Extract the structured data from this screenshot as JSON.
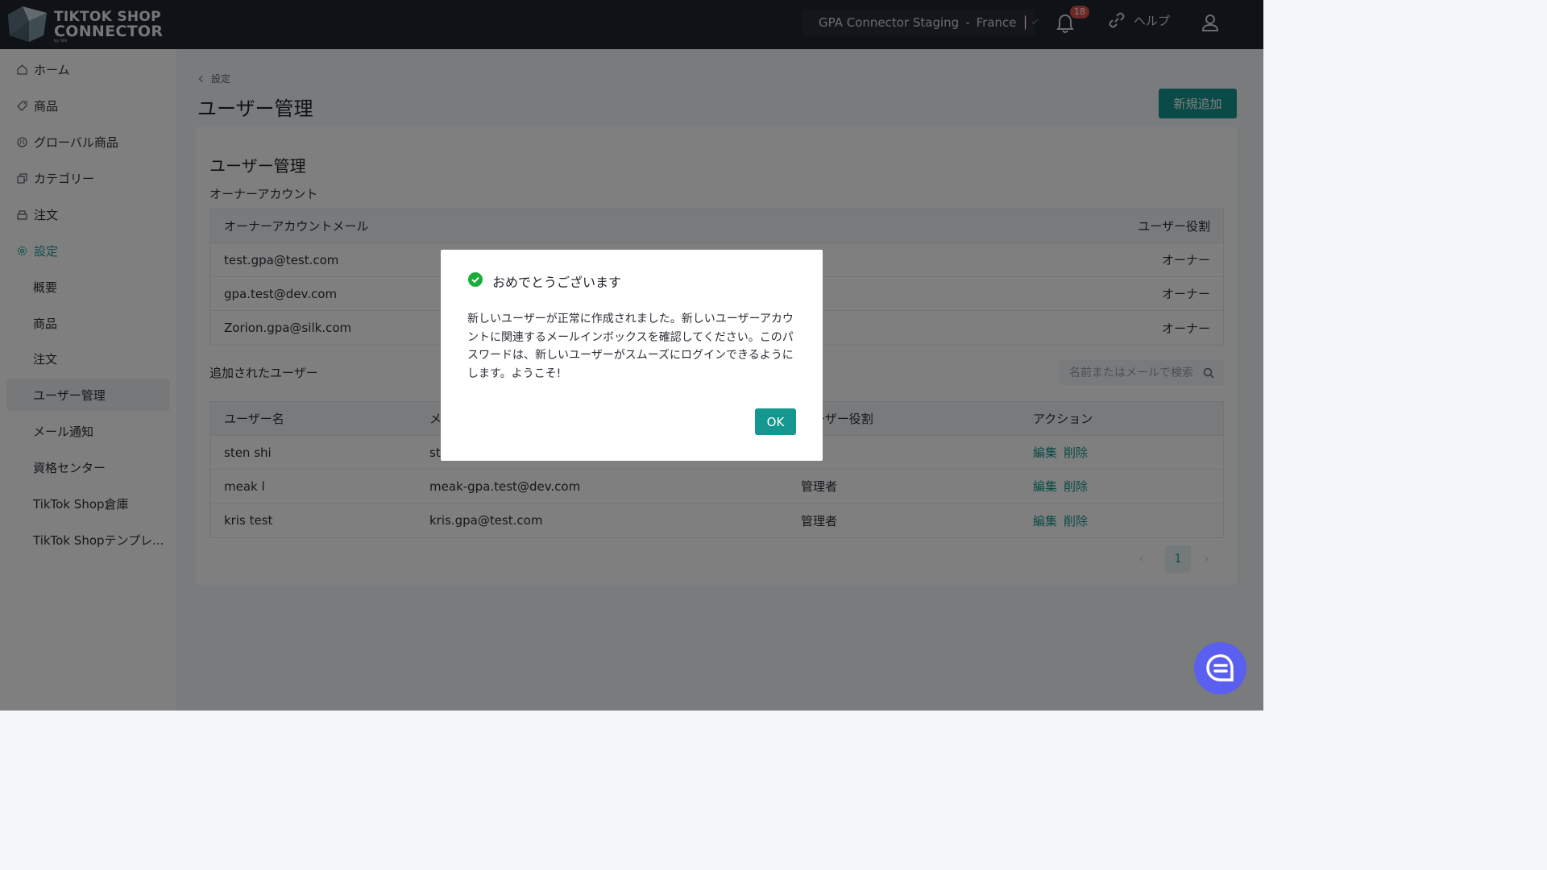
{
  "header": {
    "logo": {
      "line1": "TIKTOK SHOP",
      "line2": "CONNECTOR",
      "byline": "by Silk"
    },
    "store": {
      "name": "GPA Connector Staging",
      "separator": "-",
      "country": "France"
    },
    "notifications_count": "18",
    "help_label": "ヘルプ"
  },
  "sidebar": {
    "items": [
      {
        "label": "ホーム",
        "icon": "home-icon"
      },
      {
        "label": "商品",
        "icon": "tag-icon"
      },
      {
        "label": "グローバル商品",
        "icon": "globe-icon"
      },
      {
        "label": "カテゴリー",
        "icon": "category-icon"
      },
      {
        "label": "注文",
        "icon": "order-icon"
      },
      {
        "label": "設定",
        "icon": "gear-icon",
        "active": true
      }
    ],
    "sub_items": [
      {
        "label": "概要"
      },
      {
        "label": "商品"
      },
      {
        "label": "注文"
      },
      {
        "label": "ユーザー管理",
        "selected": true
      },
      {
        "label": "メール通知"
      },
      {
        "label": "資格センター"
      },
      {
        "label": "TikTok Shop倉庫"
      },
      {
        "label": "TikTok Shopテンプレ..."
      }
    ]
  },
  "main": {
    "breadcrumb": "設定",
    "title": "ユーザー管理",
    "add_button": "新規追加",
    "card_title": "ユーザー管理",
    "owner_section": {
      "label": "オーナーアカウント",
      "headers": [
        "オーナーアカウントメール",
        "ユーザー役割"
      ],
      "rows": [
        {
          "email": "test.gpa@test.com",
          "role": "オーナー"
        },
        {
          "email": "gpa.test@dev.com",
          "role": "オーナー"
        },
        {
          "email": "Zorion.gpa@silk.com",
          "role": "オーナー"
        }
      ]
    },
    "users_section": {
      "label": "追加されたユーザー",
      "search_placeholder": "名前またはメールで検索",
      "headers": [
        "ユーザー名",
        "メール",
        "ユーザー役割",
        "アクション"
      ],
      "rows": [
        {
          "name": "sten shi",
          "email": "ste",
          "role": "者",
          "edit": "編集",
          "delete": "削除"
        },
        {
          "name": "meak l",
          "email": "meak-gpa.test@dev.com",
          "role": "管理者",
          "edit": "編集",
          "delete": "削除"
        },
        {
          "name": "kris test",
          "email": "kris.gpa@test.com",
          "role": "管理者",
          "edit": "編集",
          "delete": "削除"
        }
      ],
      "page": "1"
    }
  },
  "modal": {
    "title": "おめでとうございます",
    "body": "新しいユーザーが正常に作成されました。新しいユーザーアカウントに関連するメールインボックスを確認してください。このパスワードは、新しいユーザーがスムーズにログインできるようにします。ようこそ!",
    "ok_label": "OK"
  },
  "colors": {
    "accent": "#14978f",
    "header_bg": "#1f242c",
    "chat": "#5a5ff0",
    "badge": "#d9534f"
  }
}
